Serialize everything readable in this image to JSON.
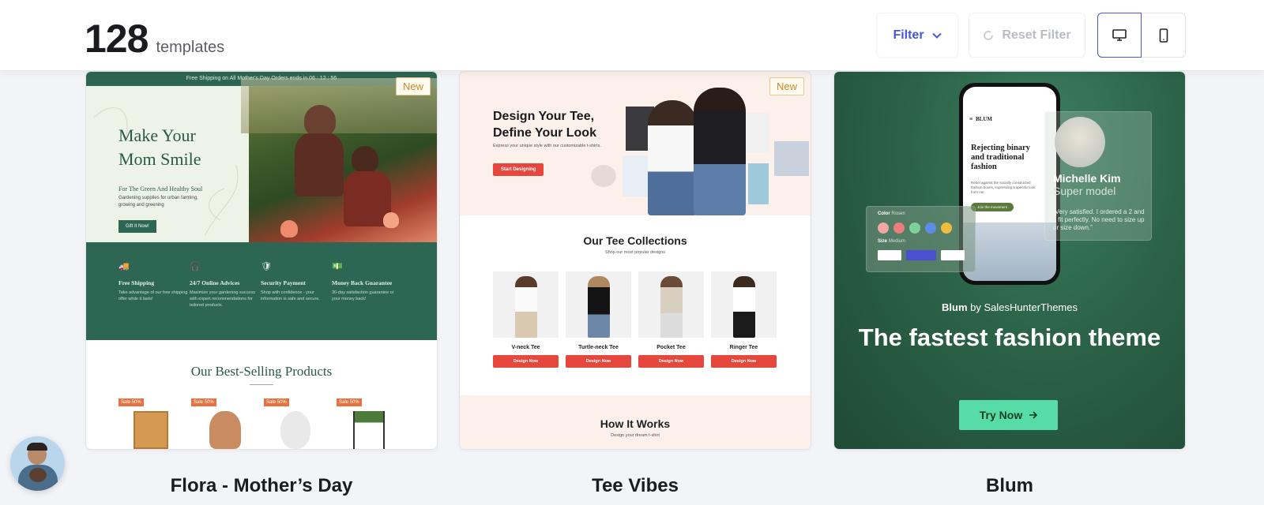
{
  "header": {
    "count": "128",
    "count_label": "templates",
    "filter_label": "Filter",
    "reset_label": "Reset Filter",
    "view_desktop_icon": "desktop-icon",
    "view_mobile_icon": "mobile-icon",
    "accent_color": "#4a57d8"
  },
  "cards": [
    {
      "title": "Flora - Mother’s Day",
      "badge": "New",
      "preview": {
        "topbar": "Free Shipping on All Mother's Day Orders ends in 06 : 12 : 56",
        "headline": "Make Your Mom Smile",
        "subheading": "For The Green And Healthy Soul",
        "text": "Gardening supplies for urban farming, growing and greening",
        "cta": "Gift It Now!",
        "features": [
          {
            "icon": "truck-icon",
            "title": "Free Shipping",
            "desc": "Take advantage of our free shipping offer while it lasts!"
          },
          {
            "icon": "headset-icon",
            "title": "24/7 Online Advices",
            "desc": "Maximize your gardening success with expert recommendations for tailored products."
          },
          {
            "icon": "shield-icon",
            "title": "Security Payment",
            "desc": "Shop with confidence - your information is safe and secure."
          },
          {
            "icon": "money-icon",
            "title": "Money Back Guarantee",
            "desc": "30-day satisfaction guarantee or your money back!"
          }
        ],
        "section_title": "Our Best-Selling Products",
        "sale_badge": "Sale 50%",
        "theme_color": "#2d6652"
      }
    },
    {
      "title": "Tee Vibes",
      "badge": "New",
      "preview": {
        "headline": "Design Your Tee, Define Your Look",
        "subheading": "Express your unique style with our customizable t-shirts.",
        "cta": "Start Designing",
        "collections_title": "Our Tee Collections",
        "collections_sub": "Shop our most popular designs",
        "items": [
          {
            "name": "V-neck Tee",
            "button": "Design Now"
          },
          {
            "name": "Turtle-neck Tee",
            "button": "Design Now"
          },
          {
            "name": "Pocket Tee",
            "button": "Design Now"
          },
          {
            "name": "Ringer Tee",
            "button": "Design Now"
          }
        ],
        "how_title": "How It Works",
        "how_sub": "Design your dream t-shirt",
        "accent_color": "#e5473d"
      }
    },
    {
      "title": "Blum",
      "preview": {
        "phone_brand": "BLUM",
        "phone_title": "Rejecting binary and traditional fashion",
        "phone_body": "Rebel against the socially constructed fashion boxes, expressing a specific look from me.",
        "phone_cta": "Join the movement",
        "color_label": "Color",
        "color_value": "Rosen",
        "size_label": "Size",
        "size_value": "Medium",
        "person_name": "Michelle Kim",
        "person_role": "Super model",
        "quote": "“Very satisfied. I ordered a 2 and it fit perfectly. No need to size up or size down.”",
        "by_brand": "Blum",
        "by_word": "by",
        "by_vendor": "SalesHunterThemes",
        "headline": "The fastest fashion theme",
        "cta": "Try Now",
        "accent_color": "#56dca4"
      }
    }
  ]
}
